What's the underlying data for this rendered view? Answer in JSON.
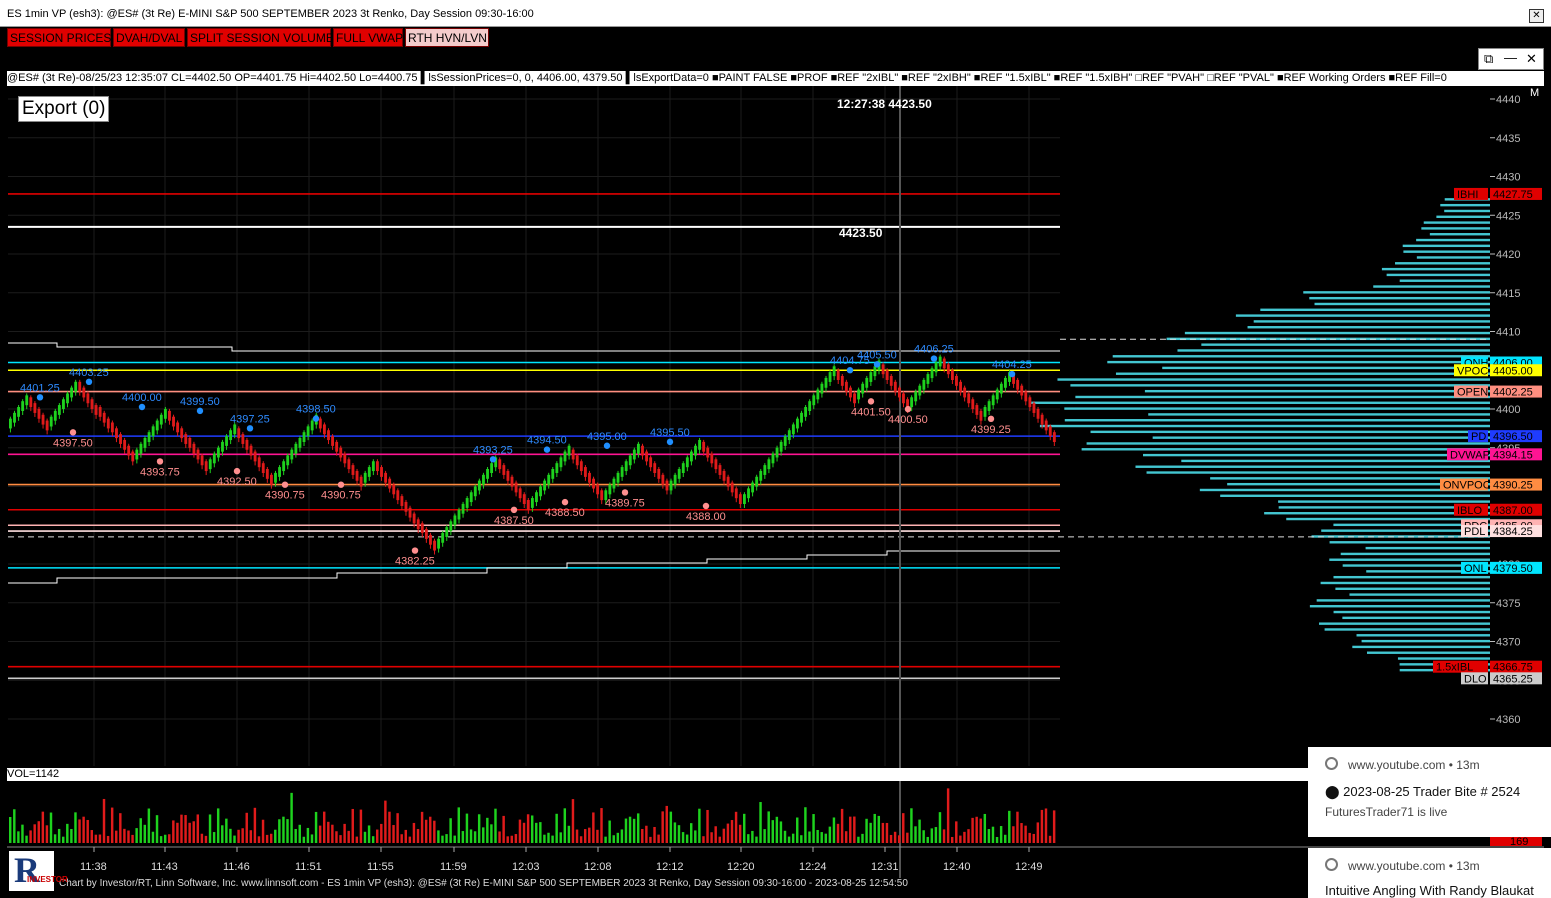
{
  "window": {
    "title": "ES 1min VP (esh3): @ES# (3t Re) E-MINI S&P 500 SEPTEMBER 2023 3t Renko, Day Session 09:30-16:00",
    "close_glyph": "✕"
  },
  "toolbar_buttons": [
    {
      "label": "SESSION PRICES"
    },
    {
      "label": "DVAH/DVAL"
    },
    {
      "label": "SPLIT SESSION VOLUME"
    },
    {
      "label": "FULL VWAP"
    },
    {
      "label": "RTH HVN/LVN"
    }
  ],
  "chart_controls": {
    "restore": "⧉",
    "minimize": "—",
    "close": "✕"
  },
  "info_bar": {
    "text": "@ES# (3t Re)-08/25/23 12:35:07 CL=4402.50 OP=4401.75 Hi=4402.50 Lo=4400.75 ▌lsSessionPrices=0, 0, 4406.00, 4379.50 ▌lsExportData=0 ■PAINT FALSE ■PROF ■REF \"2xIBL\" ■REF \"2xIBH\" ■REF \"1.5xIBL\" ■REF \"1.5xIBH\" □REF \"PVAH\" □REF \"PVAL\" ■REF Working Orders ■REF Fill=0"
  },
  "export_label": "Export (0)",
  "crosshair": {
    "time": "12:27:38",
    "price": "4423.50",
    "line_label": "4423.50"
  },
  "scale_marker": "M",
  "chart_data": {
    "type": "renko-price-chart",
    "y_axis": {
      "min": 4355,
      "max": 4445,
      "ticks": [
        4440,
        4435,
        4430,
        4425,
        4420,
        4415,
        4410,
        4405,
        4400,
        4395,
        4390,
        4385,
        4380,
        4375,
        4370,
        4365,
        4360
      ]
    },
    "x_axis": {
      "labels": [
        "11:38",
        "11:43",
        "11:46",
        "11:51",
        "11:55",
        "11:59",
        "12:03",
        "12:08",
        "12:12",
        "12:20",
        "12:24",
        "12:31",
        "12:40",
        "12:49"
      ]
    },
    "price_path": [
      4397.75,
      4401.25,
      4398,
      4403.25,
      4400,
      4398,
      4393.75,
      4396,
      4399.5,
      4396,
      4392.5,
      4397.25,
      4390.75,
      4398.5,
      4390.75,
      4393,
      4385,
      4382.25,
      4386,
      4393.25,
      4387.5,
      4394.5,
      4388.5,
      4395,
      4389.75,
      4395.5,
      4388,
      4397,
      4404.75,
      4401.5,
      4405.5,
      4400.5,
      4406.25,
      4399.25,
      4404.25,
      4396.25
    ],
    "swing_labels": [
      {
        "price": 4401.25,
        "text": "4401.25",
        "kind": "high"
      },
      {
        "price": 4403.25,
        "text": "4403.25",
        "kind": "high"
      },
      {
        "price": 4400.0,
        "text": "4400.00",
        "kind": "high"
      },
      {
        "price": 4399.5,
        "text": "4399.50",
        "kind": "high"
      },
      {
        "price": 4397.25,
        "text": "4397.25",
        "kind": "high"
      },
      {
        "price": 4398.5,
        "text": "4398.50",
        "kind": "high"
      },
      {
        "price": 4393.25,
        "text": "4393.25",
        "kind": "high"
      },
      {
        "price": 4394.5,
        "text": "4394.50",
        "kind": "high"
      },
      {
        "price": 4395.0,
        "text": "4395.00",
        "kind": "high"
      },
      {
        "price": 4395.5,
        "text": "4395.50",
        "kind": "high"
      },
      {
        "price": 4404.75,
        "text": "4404.75",
        "kind": "high"
      },
      {
        "price": 4405.5,
        "text": "4405.50",
        "kind": "high"
      },
      {
        "price": 4406.25,
        "text": "4406.25",
        "kind": "high"
      },
      {
        "price": 4404.25,
        "text": "4404.25",
        "kind": "high"
      },
      {
        "price": 4397.5,
        "text": "4397.50",
        "kind": "low"
      },
      {
        "price": 4393.75,
        "text": "4393.75",
        "kind": "low"
      },
      {
        "price": 4392.5,
        "text": "4392.50",
        "kind": "low"
      },
      {
        "price": 4390.75,
        "text": "4390.75",
        "kind": "low"
      },
      {
        "price": 4390.75,
        "text": "4390.75",
        "kind": "low"
      },
      {
        "price": 4382.25,
        "text": "4382.25",
        "kind": "low"
      },
      {
        "price": 4387.5,
        "text": "4387.50",
        "kind": "low"
      },
      {
        "price": 4388.5,
        "text": "4388.50",
        "kind": "low"
      },
      {
        "price": 4389.75,
        "text": "4389.75",
        "kind": "low"
      },
      {
        "price": 4388.0,
        "text": "4388.00",
        "kind": "low"
      },
      {
        "price": 4401.5,
        "text": "4401.50",
        "kind": "low"
      },
      {
        "price": 4400.5,
        "text": "4400.50",
        "kind": "low"
      },
      {
        "price": 4399.25,
        "text": "4399.25",
        "kind": "low"
      }
    ],
    "levels": [
      {
        "name": "IBHI",
        "value": "4427.75",
        "price": 4427.75,
        "color": "#e00000"
      },
      {
        "name": "",
        "value": "",
        "price": 4423.5,
        "color": "#ffffff"
      },
      {
        "name": "ONH",
        "value": "4406.00",
        "price": 4406.0,
        "color": "#00e5ff"
      },
      {
        "name": "VPOC",
        "value": "4405.00",
        "price": 4405.0,
        "color": "#ffff00"
      },
      {
        "name": "OPEN",
        "value": "4402.25",
        "price": 4402.25,
        "color": "#ff8f80"
      },
      {
        "name": "PD",
        "value": "4396.50",
        "price": 4396.5,
        "color": "#1f3cff"
      },
      {
        "name": "DVWAP",
        "value": "4394.15",
        "price": 4394.15,
        "color": "#ff1493"
      },
      {
        "name": "ONVPOC",
        "value": "4390.25",
        "price": 4390.25,
        "color": "#ff8c42"
      },
      {
        "name": "IBLO",
        "value": "4387.00",
        "price": 4387.0,
        "color": "#e00000"
      },
      {
        "name": "PDC",
        "value": "4385.00",
        "price": 4385.0,
        "color": "#ffb3b3"
      },
      {
        "name": "PDL",
        "value": "4384.25",
        "price": 4384.25,
        "color": "#ffe0e0"
      },
      {
        "name": "ONL",
        "value": "4379.50",
        "price": 4379.5,
        "color": "#00e5ff"
      },
      {
        "name": "1.5xIBL",
        "value": "4366.75",
        "price": 4366.75,
        "color": "#e00000"
      },
      {
        "name": "DLO",
        "value": "4365.25",
        "price": 4365.25,
        "color": "#cccccc"
      }
    ]
  },
  "volume_pane": {
    "legend": "VOL=1142",
    "last_value": "169"
  },
  "footer": {
    "text": "Chart by Investor/RT, Linn Software, Inc. www.linnsoft.com - ES 1min VP (esh3): @ES# (3t Re) E-MINI S&P 500 SEPTEMBER 2023 3t Renko, Day Session 09:30-16:00 - 2023-08-25 12:54:50",
    "logo_letter": "R",
    "logo_sub": "INVESTOR"
  },
  "notifications": [
    {
      "source": "www.youtube.com  •  13m",
      "headline": "⬤ 2023-08-25 Trader Bite # 2524",
      "body": "FuturesTrader71 is live"
    },
    {
      "source": "www.youtube.com  •  13m",
      "headline": "Intuitive Angling With Randy Blaukat",
      "body": ""
    }
  ]
}
